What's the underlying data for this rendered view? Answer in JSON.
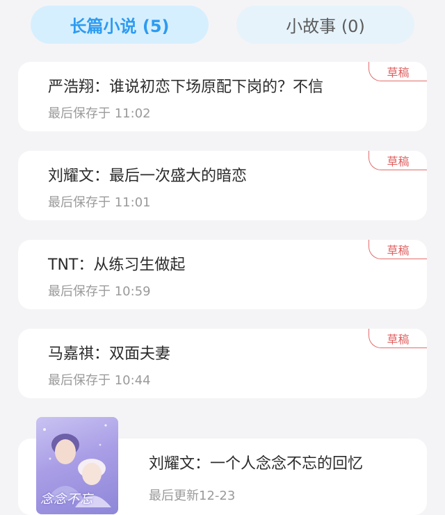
{
  "tabs": {
    "long": "长篇小说 (5)",
    "short": "小故事 (0)"
  },
  "drafts": [
    {
      "title": "严浩翔：谁说初恋下场原配下岗的？不信",
      "meta": "最后保存于 11:02",
      "badge": "草稿"
    },
    {
      "title": "刘耀文：最后一次盛大的暗恋",
      "meta": "最后保存于 11:01",
      "badge": "草稿"
    },
    {
      "title": "TNT：从练习生做起",
      "meta": "最后保存于 10:59",
      "badge": "草稿"
    },
    {
      "title": "马嘉祺：双面夫妻",
      "meta": "最后保存于 10:44",
      "badge": "草稿"
    }
  ],
  "published": {
    "title": "刘耀文：一个人念念不忘的回忆",
    "meta": "最后更新12-23",
    "cover_text": "念念不忘"
  },
  "colors": {
    "tab_active_bg": "#d6efff",
    "tab_active_text": "#2d9bf0",
    "badge": "#e26b6b"
  }
}
